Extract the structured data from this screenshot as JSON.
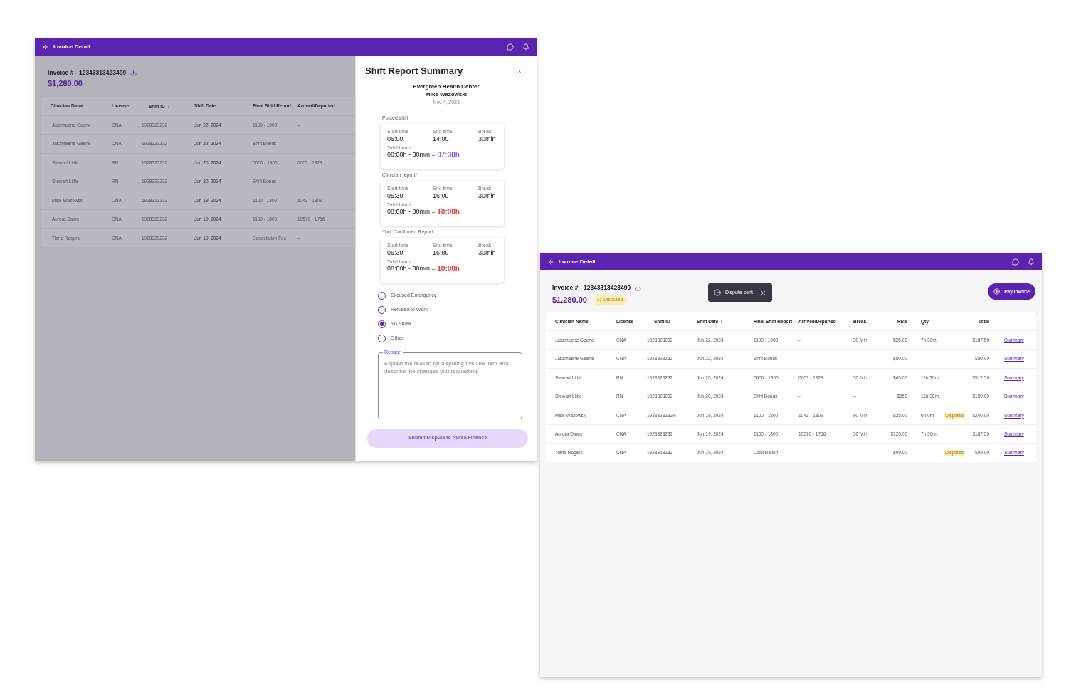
{
  "left_window": {
    "title": "Invoice Detail",
    "invoice_number": "Invoice # - 12343313423499",
    "amount": "$1,280.00",
    "columns": [
      {
        "label": "Clinician Name",
        "sorted": false
      },
      {
        "label": "License",
        "sorted": false
      },
      {
        "label": "Shift ID",
        "sorted": true
      },
      {
        "label": "Shift Date",
        "sorted": false
      },
      {
        "label": "Final Shift Report",
        "sorted": false
      },
      {
        "label": "Arrived/Departed",
        "sorted": false
      }
    ],
    "rows": [
      {
        "cells": [
          "Jaszmeene Geene",
          "CNA",
          "1928323232",
          "Jun 22, 2024",
          "1100 - 1900",
          "--"
        ]
      },
      {
        "cells": [
          "Jaszmeene Geene",
          "CNA",
          "1928323232",
          "Jun 22, 2024",
          "Shift Bonus",
          "--"
        ]
      },
      {
        "cells": [
          "Stewart Little",
          "RN",
          "1928323232",
          "Jun 20, 2024",
          "0600 - 1800",
          "0603 - 1823"
        ]
      },
      {
        "cells": [
          "Stewart Little",
          "RN",
          "1928323232",
          "Jun 20, 2024",
          "Shift Bonus",
          "--"
        ]
      },
      {
        "cells": [
          "Mike Wazowski",
          "CNA",
          "1928323232",
          "Jun 19, 2024",
          "1100 - 1800",
          "1043 - 1809"
        ]
      },
      {
        "cells": [
          "Aurora Dawn",
          "CNA",
          "1928323232",
          "Jun 19, 2024",
          "1100 - 1800",
          "10570 - 1756"
        ]
      },
      {
        "cells": [
          "Tiana Rogers",
          "CNA",
          "1928323232",
          "Jun 19, 2024",
          "Cancelation Fee",
          "--"
        ]
      }
    ],
    "drawer": {
      "title": "Shift Report Summary",
      "facility": "Evergreen Health Center",
      "clinician": "Mike Wazowski",
      "date": "Nov 4, 2023",
      "sections": [
        {
          "label": "Posted shift",
          "start_label": "Start time",
          "start": "06:00",
          "end_label": "End time",
          "end": "14:00",
          "break_label": "Break",
          "break": "30min",
          "total_label": "Total hours",
          "total": "08:00h - 30min = ",
          "result": "07:30h",
          "color": "#8b5cf6"
        },
        {
          "label": "Clinician report*",
          "start_label": "Start time",
          "start": "05:30",
          "end_label": "End time",
          "end": "16:00",
          "break_label": "Break",
          "break": "30min",
          "total_label": "Total hours",
          "total": "08:00h - 30min = ",
          "result": "10:00h",
          "color": "#e53935"
        },
        {
          "label": "Your Confirmed Report",
          "start_label": "Start time",
          "start": "05:30",
          "end_label": "End time",
          "end": "16:00",
          "break_label": "Break",
          "break": "30min",
          "total_label": "Total hours",
          "total": "08:00h - 30min = ",
          "result": "10:00h",
          "color": "#e53935"
        }
      ],
      "reasons": [
        {
          "label": "Excused Emergency",
          "selected": false
        },
        {
          "label": "Refused to Work",
          "selected": false
        },
        {
          "label": "No Show",
          "selected": true
        },
        {
          "label": "Other",
          "selected": false
        }
      ],
      "reason_field": {
        "label": "Reason",
        "placeholder": "Explain the reason for disputing this line item and describe the changes you requesting."
      },
      "submit": {
        "label": "Submit Dispute to Nursa Finance",
        "disabled": true
      }
    }
  },
  "right_window": {
    "title": "Invoice Detail",
    "invoice_number": "Invoice # - 12343313423499",
    "amount": "$1,280.00",
    "status": "Disputed",
    "toast": "Dispute sent",
    "pay_button": "Pay Invoice",
    "columns": [
      {
        "label": "Clinician Name",
        "sorted": false
      },
      {
        "label": "License",
        "sorted": false
      },
      {
        "label": "Shift ID",
        "sorted": false
      },
      {
        "label": "Shift Date",
        "sorted": true
      },
      {
        "label": "Final Shift Report",
        "sorted": false
      },
      {
        "label": "Arrived/Departed",
        "sorted": false
      },
      {
        "label": "Break",
        "sorted": false
      },
      {
        "label": "Rate",
        "sorted": false
      },
      {
        "label": "Qty",
        "sorted": false
      },
      {
        "label": "Total",
        "sorted": false
      }
    ],
    "rows": [
      {
        "cells": [
          "Jaszmeene Geene",
          "CNA",
          "1928323232",
          "Jun 22, 2024",
          "1100 - 1900",
          "--",
          "30 Min",
          "$25.00",
          "7h 30m"
        ],
        "total": "$187.50",
        "link": "Summary"
      },
      {
        "cells": [
          "Jaszmeene Geene",
          "CNA",
          "1928323232",
          "Jun 22, 2024",
          "Shift Bonus",
          "--",
          "--",
          "$50.00",
          "--"
        ],
        "total": "$50.00",
        "link": "Summary"
      },
      {
        "cells": [
          "Stewart Little",
          "RN",
          "1928323232",
          "Jun 20, 2024",
          "0600 - 1800",
          "0603 - 1823",
          "30 Min",
          "$45.00",
          "11h 30m"
        ],
        "total": "$517.50",
        "link": "Summary"
      },
      {
        "cells": [
          "Stewart Little",
          "RN",
          "1928323232",
          "Jun 20, 2024",
          "Shift Bonus",
          "--",
          "--",
          "$150",
          "11h 30m"
        ],
        "total": "$150.00",
        "link": "Summary"
      },
      {
        "cells": [
          "Mike Wazowski",
          "CNA",
          "1928323232R",
          "Jun 19, 2024",
          "1100 - 1800",
          "1043 - 1809",
          "90 Min",
          "$25.00",
          "6h 0m"
        ],
        "badge": "Disputed",
        "total": "$240.00",
        "link": "Summary"
      },
      {
        "cells": [
          "Aurora Dawn",
          "CNA",
          "1928323232",
          "Jun 19, 2024",
          "1100 - 1800",
          "10570 - 1756",
          "30 Min",
          "$325.00",
          "7h 30m"
        ],
        "total": "$187.50",
        "link": "Summary"
      },
      {
        "cells": [
          "Tiana Rogers",
          "CNA",
          "1928323232",
          "Jun 19, 2024",
          "Cancelation",
          "--",
          "--",
          "$99.00",
          "--"
        ],
        "badge": "Disputed",
        "total": "$99.00",
        "link": "Summary"
      }
    ]
  }
}
